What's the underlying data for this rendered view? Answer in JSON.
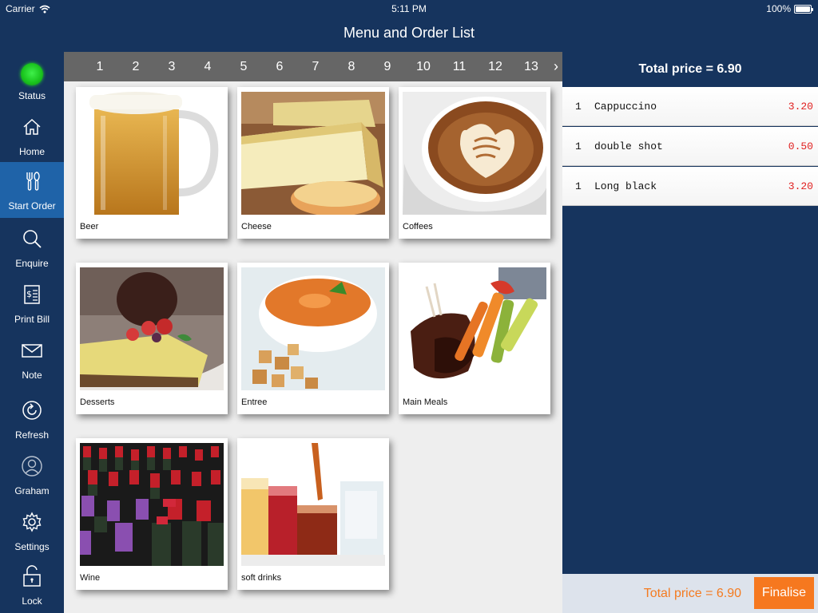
{
  "status_bar": {
    "carrier": "Carrier",
    "time": "5:11 PM",
    "battery": "100%"
  },
  "header": {
    "title": "Menu and Order List"
  },
  "sidebar": {
    "status_label": "Status",
    "items": [
      {
        "label": "Home",
        "icon": "home-icon"
      },
      {
        "label": "Start Order",
        "icon": "cutlery-icon",
        "active": true
      },
      {
        "label": "Enquire",
        "icon": "search-icon"
      },
      {
        "label": "Print Bill",
        "icon": "bill-icon"
      },
      {
        "label": "Note",
        "icon": "envelope-icon"
      },
      {
        "label": "Refresh",
        "icon": "refresh-icon"
      },
      {
        "label": "Graham",
        "icon": "user-icon"
      },
      {
        "label": "Settings",
        "icon": "gear-icon"
      },
      {
        "label": "Lock",
        "icon": "lock-icon"
      }
    ],
    "status_color": "#2ecc40"
  },
  "pages": [
    "1",
    "2",
    "3",
    "4",
    "5",
    "6",
    "7",
    "8",
    "9",
    "10",
    "11",
    "12",
    "13"
  ],
  "categories": [
    {
      "label": "Beer",
      "image": "beer"
    },
    {
      "label": "Cheese",
      "image": "cheese"
    },
    {
      "label": "Coffees",
      "image": "coffee"
    },
    {
      "label": "Desserts",
      "image": "dessert"
    },
    {
      "label": "Entree",
      "image": "soup"
    },
    {
      "label": "Main Meals",
      "image": "main-meal"
    },
    {
      "label": "Wine",
      "image": "wine"
    },
    {
      "label": "soft drinks",
      "image": "soft-drinks"
    }
  ],
  "order": {
    "total_header": "Total price = 6.90",
    "items": [
      {
        "qty": "1",
        "name": "Cappuccino",
        "price": "3.20"
      },
      {
        "qty": "1",
        "name": "double shot",
        "price": "0.50"
      },
      {
        "qty": "1",
        "name": "Long black",
        "price": "3.20"
      }
    ],
    "footer_total": "Total price = 6.90",
    "finalise_label": "Finalise"
  },
  "colors": {
    "navy": "#16345e",
    "active_blue": "#1f63a8",
    "accent_orange": "#f6781f",
    "price_red": "#e02020"
  }
}
